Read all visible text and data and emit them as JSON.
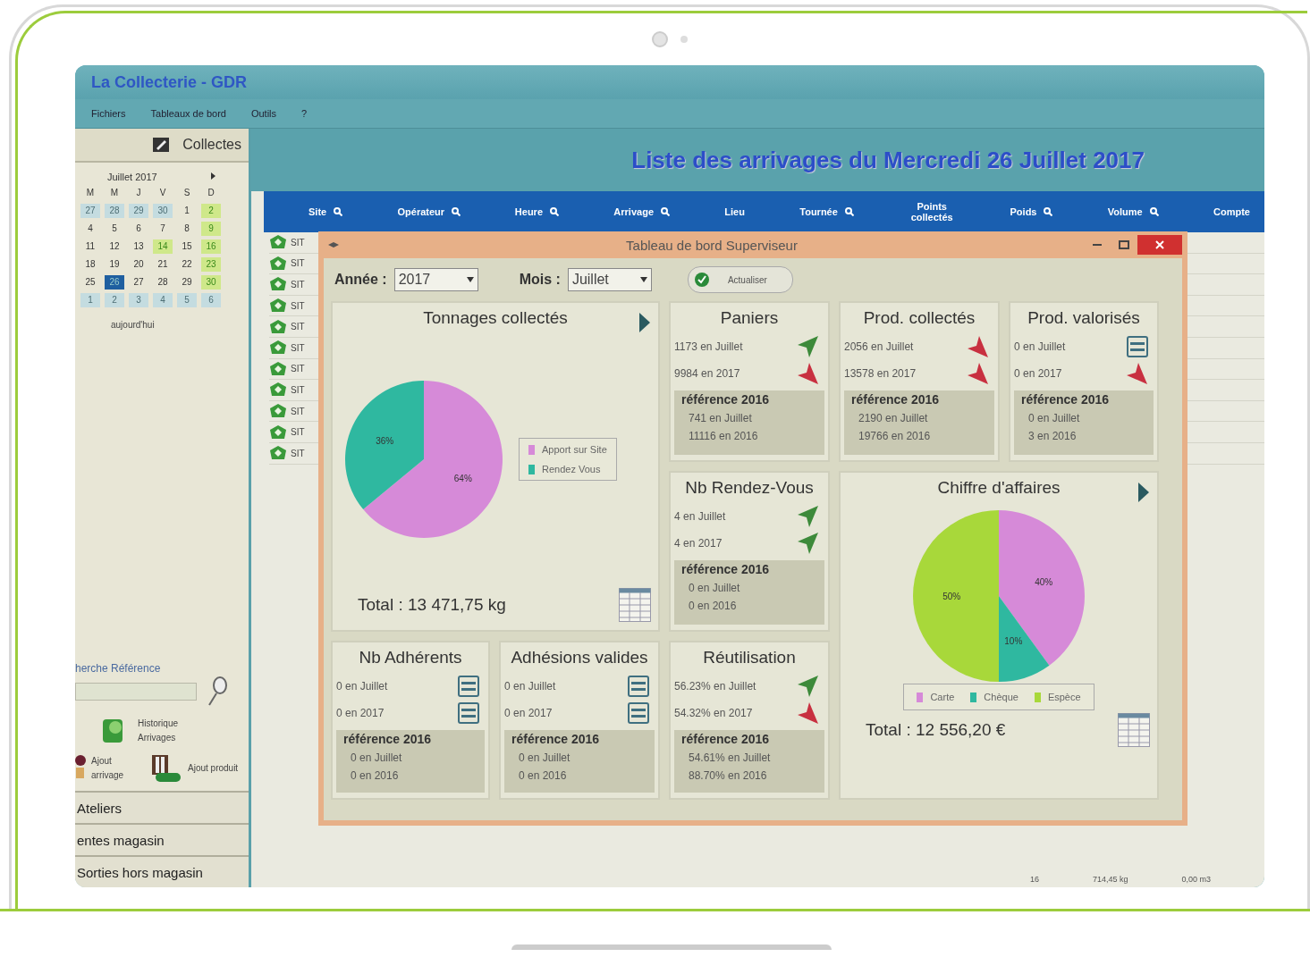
{
  "app": {
    "title": "La Collecterie - GDR",
    "menu": [
      "Fichiers",
      "Tableaux de bord",
      "Outils",
      "?"
    ]
  },
  "sidebar": {
    "header": "Collectes",
    "calendar": {
      "month": "Juillet 2017",
      "weekdays": [
        "M",
        "M",
        "J",
        "V",
        "S",
        "D"
      ],
      "weeks": [
        [
          {
            "day": "27",
            "kind": "other",
            "selected": false
          },
          {
            "day": "28",
            "kind": "other",
            "selected": false
          },
          {
            "day": "29",
            "kind": "other",
            "selected": false
          },
          {
            "day": "30",
            "kind": "other",
            "selected": false
          },
          {
            "day": "1",
            "kind": "normal",
            "selected": false
          },
          {
            "day": "2",
            "kind": "highlight",
            "selected": false
          }
        ],
        [
          {
            "day": "4",
            "kind": "normal",
            "selected": false
          },
          {
            "day": "5",
            "kind": "normal",
            "selected": false
          },
          {
            "day": "6",
            "kind": "normal",
            "selected": false
          },
          {
            "day": "7",
            "kind": "normal",
            "selected": false
          },
          {
            "day": "8",
            "kind": "normal",
            "selected": false
          },
          {
            "day": "9",
            "kind": "highlight",
            "selected": false
          }
        ],
        [
          {
            "day": "11",
            "kind": "normal",
            "selected": false
          },
          {
            "day": "12",
            "kind": "normal",
            "selected": false
          },
          {
            "day": "13",
            "kind": "normal",
            "selected": false
          },
          {
            "day": "14",
            "kind": "highlight",
            "selected": false
          },
          {
            "day": "15",
            "kind": "normal",
            "selected": false
          },
          {
            "day": "16",
            "kind": "highlight",
            "selected": false
          }
        ],
        [
          {
            "day": "18",
            "kind": "normal",
            "selected": false
          },
          {
            "day": "19",
            "kind": "normal",
            "selected": false
          },
          {
            "day": "20",
            "kind": "normal",
            "selected": false
          },
          {
            "day": "21",
            "kind": "normal",
            "selected": false
          },
          {
            "day": "22",
            "kind": "normal",
            "selected": false
          },
          {
            "day": "23",
            "kind": "highlight",
            "selected": false
          }
        ],
        [
          {
            "day": "25",
            "kind": "normal",
            "selected": false
          },
          {
            "day": "26",
            "kind": "normal",
            "selected": true
          },
          {
            "day": "27",
            "kind": "normal",
            "selected": false
          },
          {
            "day": "28",
            "kind": "normal",
            "selected": false
          },
          {
            "day": "29",
            "kind": "normal",
            "selected": false
          },
          {
            "day": "30",
            "kind": "highlight",
            "selected": false
          }
        ],
        [
          {
            "day": "1",
            "kind": "other",
            "selected": false
          },
          {
            "day": "2",
            "kind": "other",
            "selected": false
          },
          {
            "day": "3",
            "kind": "other",
            "selected": false
          },
          {
            "day": "4",
            "kind": "other",
            "selected": false
          },
          {
            "day": "5",
            "kind": "other",
            "selected": false
          },
          {
            "day": "6",
            "kind": "other",
            "selected": false
          }
        ]
      ]
    },
    "today": "aujourd'hui",
    "search": {
      "label": "herche Référence"
    },
    "actions": [
      {
        "label": "Historique Arrivages",
        "kind": "history"
      },
      {
        "label": "Ajout arrivage",
        "kind": "arrival"
      },
      {
        "label": "Ajout produit",
        "kind": "product"
      }
    ],
    "sections": [
      "Ateliers",
      "entes magasin",
      "Sorties hors magasin"
    ]
  },
  "main": {
    "heading": "Liste des arrivages du Mercredi 26 Juillet 2017",
    "columns": [
      {
        "label": "Site",
        "searchable": true
      },
      {
        "label": "Opérateur",
        "searchable": true
      },
      {
        "label": "Heure",
        "searchable": true
      },
      {
        "label": "Arrivage",
        "searchable": true
      },
      {
        "label": "Lieu",
        "searchable": false
      },
      {
        "label": "Tournée",
        "searchable": true
      },
      {
        "label": "Points collectés",
        "searchable": false
      },
      {
        "label": "Poids",
        "searchable": true
      },
      {
        "label": "Volume",
        "searchable": true
      },
      {
        "label": "Compte",
        "searchable": false
      }
    ],
    "rows": [
      "SIT",
      "SIT",
      "SIT",
      "SIT",
      "SIT",
      "SIT",
      "SIT",
      "SIT",
      "SIT",
      "SIT",
      "SIT"
    ],
    "footer": [
      "16",
      "714,45 kg",
      "0,00 m3"
    ]
  },
  "dialog": {
    "title": "Tableau de bord Superviseur",
    "year": {
      "label": "Année :",
      "value": "2017"
    },
    "month": {
      "label": "Mois :",
      "value": "Juillet"
    },
    "refresh": "Actualiser",
    "tonnage": {
      "title": "Tonnages collectés",
      "legend": [
        {
          "label": "Apport sur Site",
          "color": "#d68ad8"
        },
        {
          "label": "Rendez Vous",
          "color": "#2fb8a0"
        }
      ],
      "chart_data": {
        "type": "pie",
        "values": [
          64,
          36
        ],
        "value_labels": [
          "64%",
          "36%"
        ]
      },
      "total": "Total :  13 471,75 kg"
    },
    "revenue": {
      "title": "Chiffre d'affaires",
      "legend": [
        {
          "label": "Carte",
          "color": "#d68ad8"
        },
        {
          "label": "Chèque",
          "color": "#2fb8a0"
        },
        {
          "label": "Espèce",
          "color": "#a8d83a"
        }
      ],
      "chart_data": {
        "type": "pie",
        "values": [
          40,
          10,
          50
        ],
        "value_labels": [
          "40%",
          "10%",
          "50%"
        ]
      },
      "total": "Total :  12 556,20 €"
    },
    "cards": [
      {
        "title": "Paniers",
        "lines": [
          {
            "text": "1173 en Juillet",
            "kind": "up"
          },
          {
            "text": "9984 en 2017",
            "kind": "down"
          }
        ],
        "reference": {
          "label": "référence 2016",
          "lines": [
            "741 en Juillet",
            "11116 en 2016"
          ]
        }
      },
      {
        "title": "Prod. collectés",
        "lines": [
          {
            "text": "2056 en Juillet",
            "kind": "down"
          },
          {
            "text": "13578 en 2017",
            "kind": "down"
          }
        ],
        "reference": {
          "label": "référence 2016",
          "lines": [
            "2190 en Juillet",
            "19766 en 2016"
          ]
        }
      },
      {
        "title": "Prod. valorisés",
        "lines": [
          {
            "text": "0 en Juillet",
            "kind": "equal"
          },
          {
            "text": "0 en 2017",
            "kind": "down"
          }
        ],
        "reference": {
          "label": "référence 2016",
          "lines": [
            "0 en Juillet",
            "3 en 2016"
          ]
        }
      },
      {
        "title": "Nb Rendez-Vous",
        "lines": [
          {
            "text": "4 en Juillet",
            "kind": "up"
          },
          {
            "text": "4 en 2017",
            "kind": "up"
          }
        ],
        "reference": {
          "label": "référence 2016",
          "lines": [
            "0 en Juillet",
            "0 en 2016"
          ]
        }
      },
      {
        "title": "Nb Adhérents",
        "lines": [
          {
            "text": "0 en Juillet",
            "kind": "equal"
          },
          {
            "text": "0 en 2017",
            "kind": "equal"
          }
        ],
        "reference": {
          "label": "référence 2016",
          "lines": [
            "0 en Juillet",
            "0 en 2016"
          ]
        }
      },
      {
        "title": "Adhésions valides",
        "lines": [
          {
            "text": "0 en Juillet",
            "kind": "equal"
          },
          {
            "text": "0 en 2017",
            "kind": "equal"
          }
        ],
        "reference": {
          "label": "référence 2016",
          "lines": [
            "0 en Juillet",
            "0 en 2016"
          ]
        }
      },
      {
        "title": "Réutilisation",
        "lines": [
          {
            "text": "56.23% en Juillet",
            "kind": "up"
          },
          {
            "text": "54.32% en 2017",
            "kind": "down"
          }
        ],
        "reference": {
          "label": "référence 2016",
          "lines": [
            "54.61% en Juillet",
            "88.70% en 2016"
          ]
        }
      }
    ]
  }
}
